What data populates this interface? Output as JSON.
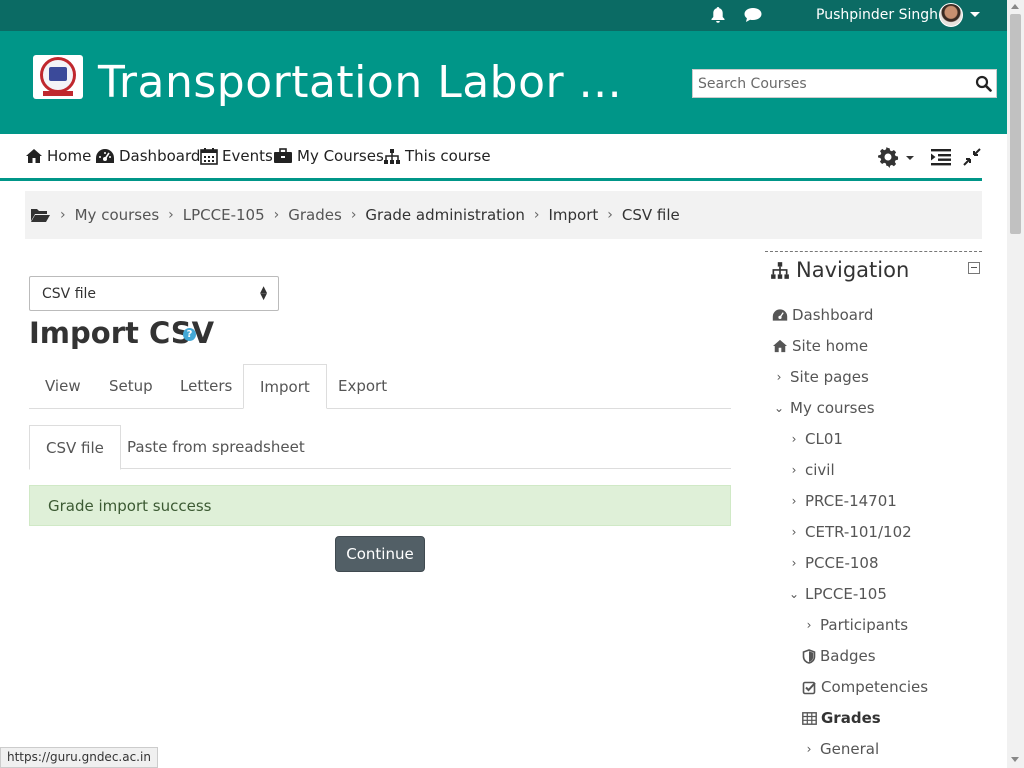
{
  "topbar": {
    "username": "Pushpinder Singh"
  },
  "header": {
    "site_title": "Transportation Labor ...",
    "search_placeholder": "Search Courses"
  },
  "nav": {
    "home": "Home",
    "dashboard": "Dashboard",
    "events": "Events",
    "my_courses": "My Courses",
    "this_course": "This course"
  },
  "breadcrumb": [
    "My courses",
    "LPCCE-105",
    "Grades",
    "Grade administration",
    "Import",
    "CSV file"
  ],
  "main": {
    "select_value": "CSV file",
    "heading": "Import CSV",
    "help": "?",
    "tabs": [
      "View",
      "Setup",
      "Letters",
      "Import",
      "Export"
    ],
    "subtabs": [
      "CSV file",
      "Paste from spreadsheet"
    ],
    "alert": "Grade import success",
    "continue": "Continue"
  },
  "navigation": {
    "title": "Navigation",
    "items": [
      "Dashboard",
      "Site home",
      "Site pages",
      "My courses",
      "CL01",
      "civil",
      "PRCE-14701",
      "CETR-101/102",
      "PCCE-108",
      "LPCCE-105",
      "Participants",
      "Badges",
      "Competencies",
      "Grades",
      "General"
    ]
  },
  "statusbar": "https://guru.gndec.ac.in",
  "colors": {
    "topbar": "#0b6b64",
    "header": "#009688",
    "alert_bg": "#dff0d8",
    "button": "#525f66"
  }
}
